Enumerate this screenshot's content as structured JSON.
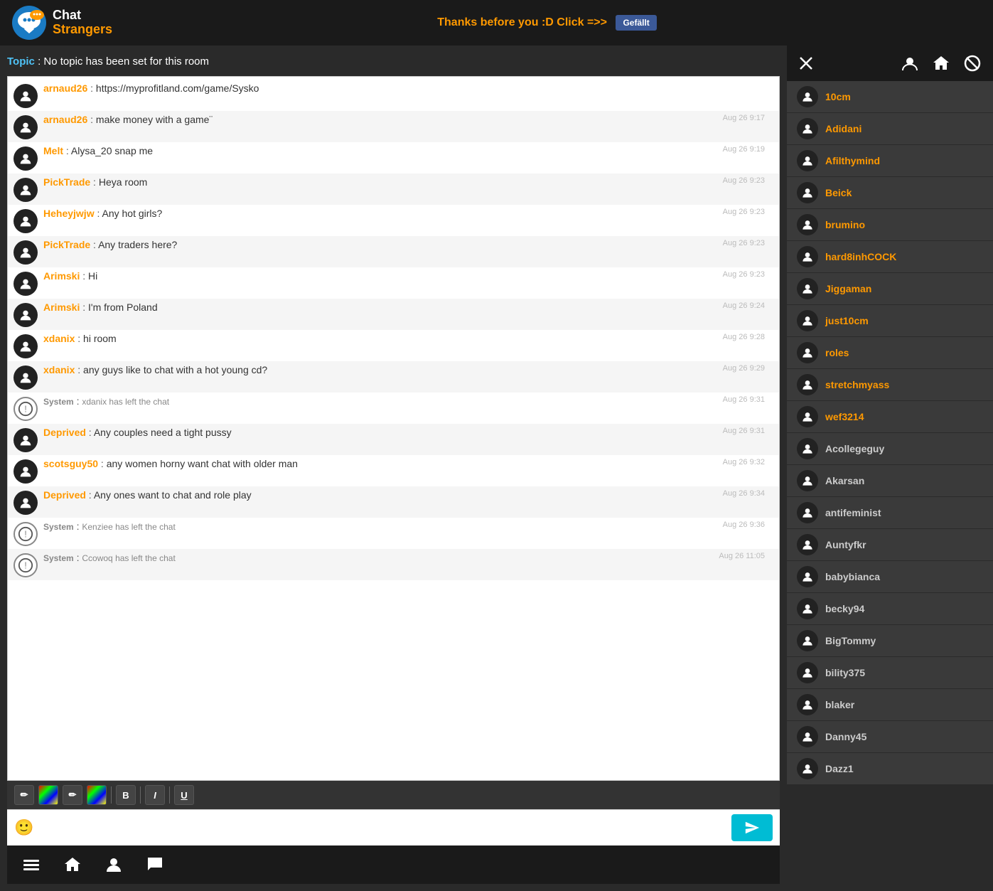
{
  "header": {
    "logo_chat": "Chat",
    "logo_strangers": "Strangers",
    "promo_text": "Thanks before you :D Click =>>",
    "fb_label": "Gefällt"
  },
  "topic": {
    "label": "Topic",
    "text": ": No topic has been set for this room"
  },
  "messages": [
    {
      "id": 1,
      "username": "arnaud26",
      "text": "https://myprofitland.com/game/Sysko",
      "time": "",
      "system": false,
      "alt": false
    },
    {
      "id": 2,
      "username": "arnaud26",
      "text": "make money with a game¨",
      "time": "Aug 26 9:17",
      "system": false,
      "alt": true
    },
    {
      "id": 3,
      "username": "Melt",
      "text": "Alysa_20 snap me",
      "time": "Aug 26 9:19",
      "system": false,
      "alt": false
    },
    {
      "id": 4,
      "username": "PickTrade",
      "text": "Heya room",
      "time": "Aug 26 9:23",
      "system": false,
      "alt": true
    },
    {
      "id": 5,
      "username": "Heheyjwjw",
      "text": "Any hot girls?",
      "time": "Aug 26 9:23",
      "system": false,
      "alt": false
    },
    {
      "id": 6,
      "username": "PickTrade",
      "text": "Any traders here?",
      "time": "Aug 26 9:23",
      "system": false,
      "alt": true
    },
    {
      "id": 7,
      "username": "Arimski",
      "text": "Hi",
      "time": "Aug 26 9:23",
      "system": false,
      "alt": false
    },
    {
      "id": 8,
      "username": "Arimski",
      "text": "I'm from Poland",
      "time": "Aug 26 9:24",
      "system": false,
      "alt": true
    },
    {
      "id": 9,
      "username": "xdanix",
      "text": "hi room",
      "time": "Aug 26 9:28",
      "system": false,
      "alt": false
    },
    {
      "id": 10,
      "username": "xdanix",
      "text": "any guys like to chat with a hot young cd?",
      "time": "Aug 26 9:29",
      "system": false,
      "alt": true
    },
    {
      "id": 11,
      "username": "System",
      "text": "xdanix has left the chat",
      "time": "Aug 26 9:31",
      "system": true,
      "alt": false
    },
    {
      "id": 12,
      "username": "Deprived",
      "text": "Any couples need a tight pussy",
      "time": "Aug 26 9:31",
      "system": false,
      "alt": true
    },
    {
      "id": 13,
      "username": "scotsguy50",
      "text": "any women horny want chat with older man",
      "time": "Aug 26 9:32",
      "system": false,
      "alt": false
    },
    {
      "id": 14,
      "username": "Deprived",
      "text": "Any ones want to chat and role play",
      "time": "Aug 26 9:34",
      "system": false,
      "alt": true
    },
    {
      "id": 15,
      "username": "System",
      "text": "Kenziee has left the chat",
      "time": "Aug 26 9:36",
      "system": true,
      "alt": false
    },
    {
      "id": 16,
      "username": "System",
      "text": "Ccowoq has left the chat",
      "time": "Aug 26 11:05",
      "system": true,
      "alt": true
    }
  ],
  "toolbar": {
    "buttons": [
      "✏",
      "🎨",
      "✏",
      "🎨",
      "B",
      "I",
      "U"
    ]
  },
  "input": {
    "placeholder": ""
  },
  "sidebar": {
    "users_orange": [
      {
        "name": "10cm"
      },
      {
        "name": "Adidani"
      },
      {
        "name": "Afilthymind"
      },
      {
        "name": "Beick"
      },
      {
        "name": "brumino"
      },
      {
        "name": "hard8inhCOCK"
      },
      {
        "name": "Jiggaman"
      },
      {
        "name": "just10cm"
      },
      {
        "name": "roles"
      },
      {
        "name": "stretchmyass"
      },
      {
        "name": "wef3214"
      }
    ],
    "users_gray": [
      {
        "name": "Acollegeguy"
      },
      {
        "name": "Akarsan"
      },
      {
        "name": "antifeminist"
      },
      {
        "name": "Auntyfkr"
      },
      {
        "name": "babybianca"
      },
      {
        "name": "becky94"
      },
      {
        "name": "BigTommy"
      },
      {
        "name": "bility375"
      },
      {
        "name": "blaker"
      },
      {
        "name": "Danny45"
      },
      {
        "name": "Dazz1"
      }
    ]
  },
  "bottom_nav": {
    "buttons": [
      "menu",
      "home",
      "user",
      "chat"
    ]
  }
}
